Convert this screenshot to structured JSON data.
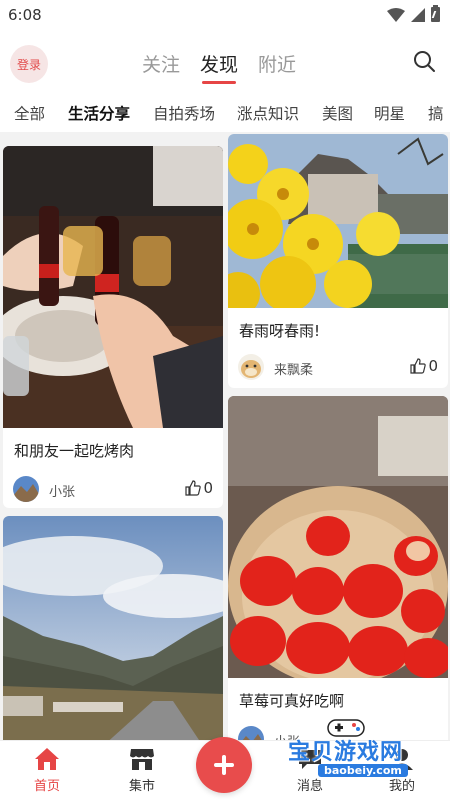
{
  "status_bar": {
    "time": "6:08"
  },
  "header": {
    "login_label": "登录",
    "tabs": [
      {
        "label": "关注",
        "active": false
      },
      {
        "label": "发现",
        "active": true
      },
      {
        "label": "附近",
        "active": false
      }
    ]
  },
  "categories": [
    {
      "label": "全部",
      "active": false
    },
    {
      "label": "生活分享",
      "active": true
    },
    {
      "label": "自拍秀场",
      "active": false
    },
    {
      "label": "涨点知识",
      "active": false
    },
    {
      "label": "美图",
      "active": false
    },
    {
      "label": "明星",
      "active": false
    },
    {
      "label": "搞",
      "active": false
    }
  ],
  "feed": {
    "left": [
      {
        "title": "和朋友一起吃烤肉",
        "author": "小张",
        "likes": "0",
        "image": "bbq-dinner-photo"
      },
      {
        "title": "",
        "author": "",
        "likes": "",
        "image": "mountain-valley-road-photo"
      }
    ],
    "right": [
      {
        "title": "春雨呀春雨!",
        "author": "来飘柔",
        "likes": "0",
        "image": "yellow-flowers-lake-photo"
      },
      {
        "title": "草莓可真好吃啊",
        "author": "小张",
        "likes": "",
        "image": "strawberries-bowl-photo"
      }
    ]
  },
  "bottom_nav": {
    "items": [
      {
        "label": "首页",
        "icon": "home-icon",
        "active": true
      },
      {
        "label": "集市",
        "icon": "market-icon",
        "active": false
      },
      {
        "label": "消息",
        "icon": "message-icon",
        "active": false
      },
      {
        "label": "我的",
        "icon": "profile-icon",
        "active": false
      }
    ],
    "add_icon": "plus-icon"
  },
  "watermark": {
    "text": "宝贝游戏网",
    "url": "baobeiy.com"
  },
  "colors": {
    "accent": "#e64545",
    "fab": "#e84c4c",
    "login_bg": "#f6e5e5"
  }
}
